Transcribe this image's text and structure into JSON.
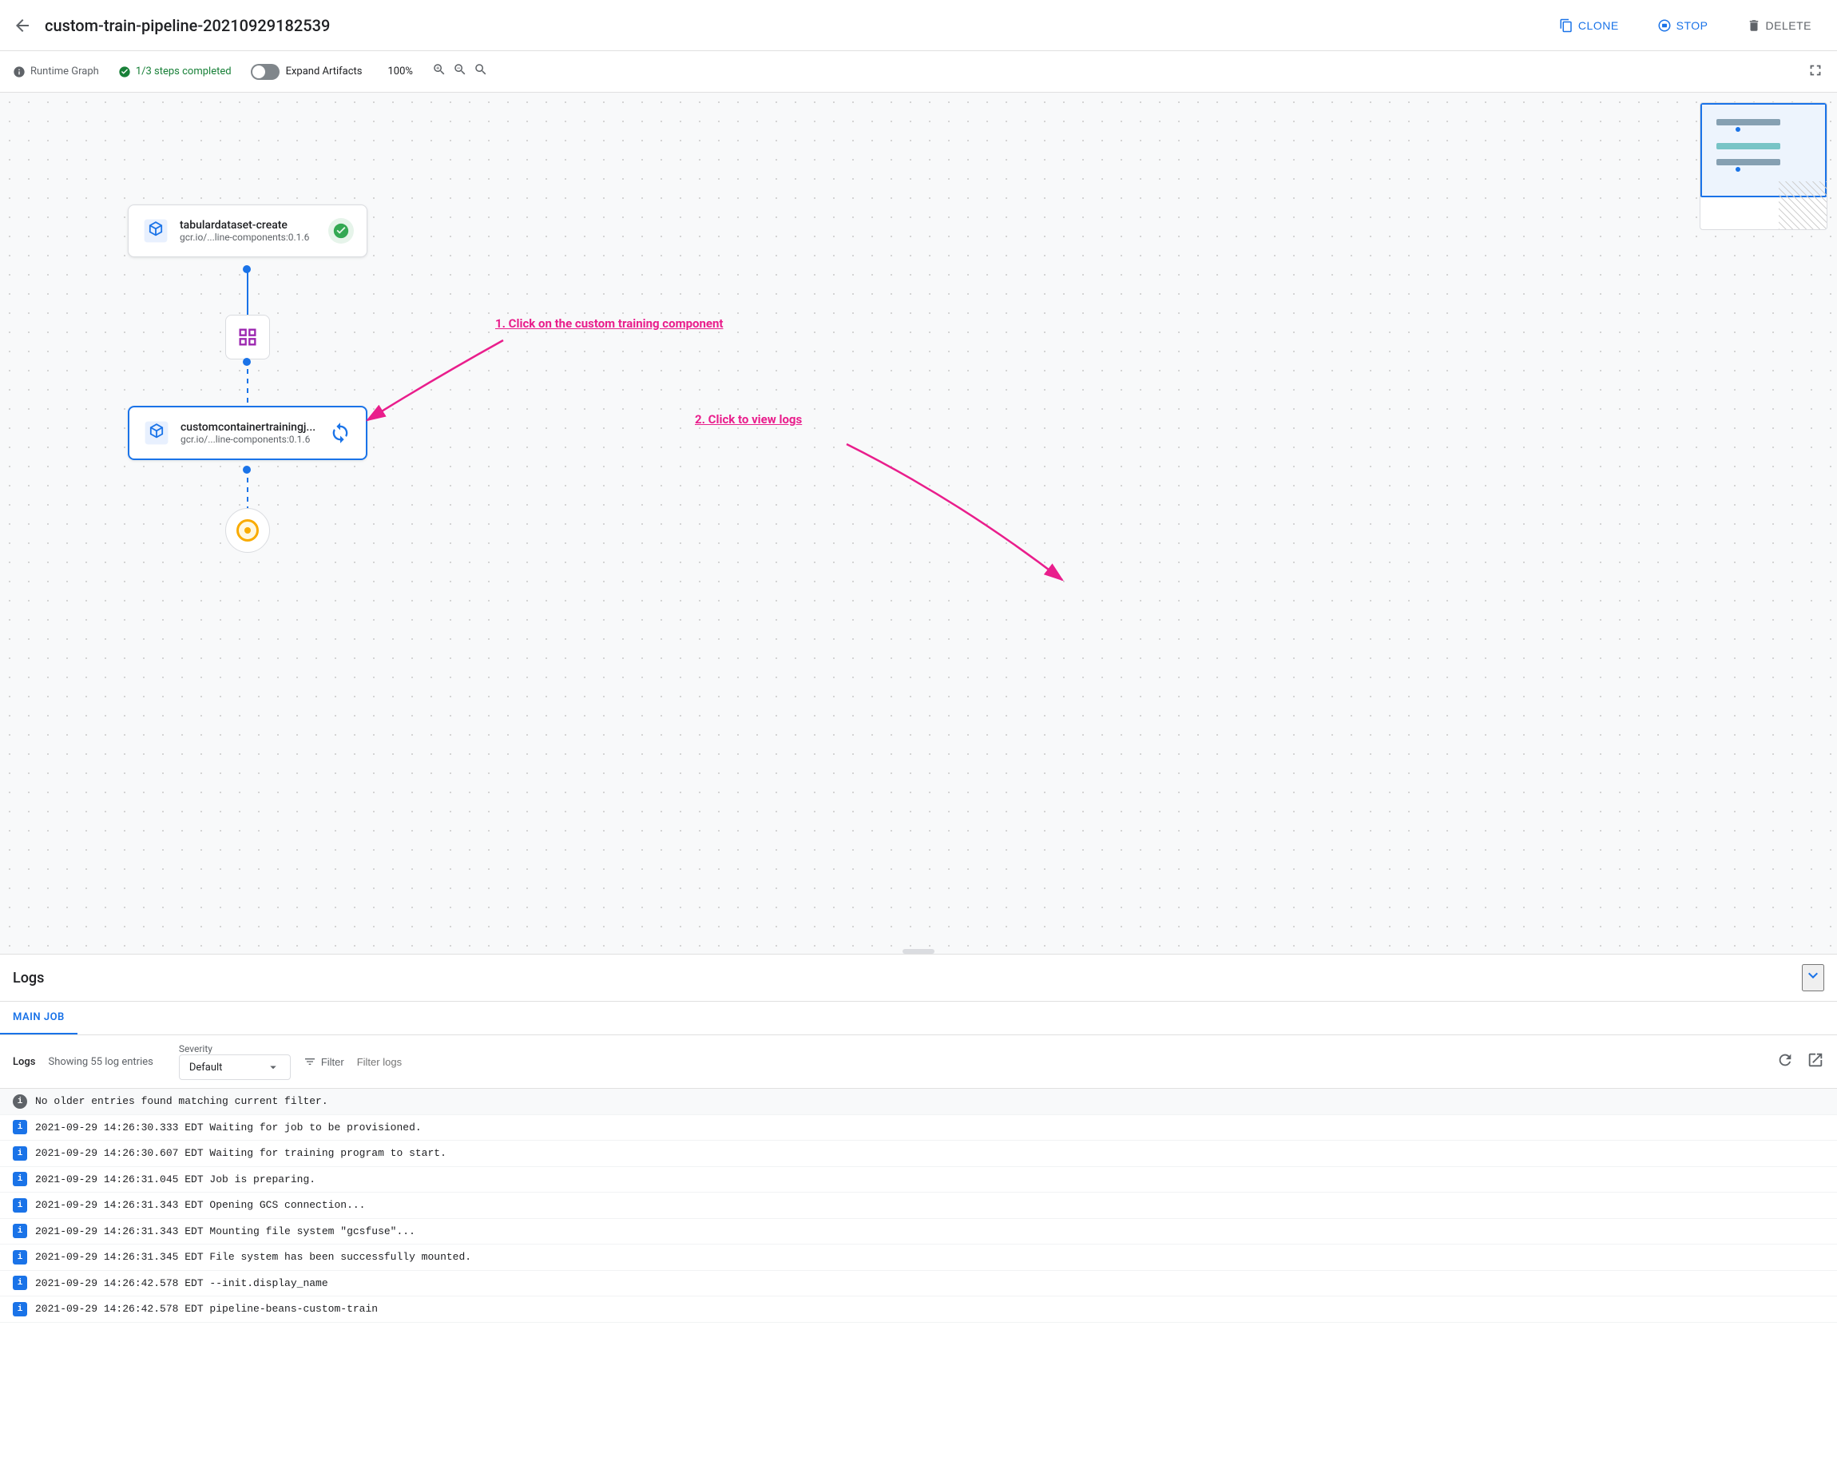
{
  "header": {
    "back_label": "←",
    "title": "custom-train-pipeline-20210929182539",
    "clone_label": "CLONE",
    "stop_label": "STOP",
    "delete_label": "DELETE"
  },
  "toolbar": {
    "runtime_graph_label": "Runtime Graph",
    "steps_completed_label": "1/3 steps completed",
    "expand_artifacts_label": "Expand Artifacts",
    "zoom_level": "100%",
    "zoom_in_label": "+",
    "zoom_out_label": "−",
    "zoom_fit_label": "⊡"
  },
  "canvas": {
    "node1": {
      "name": "tabulardataset-create",
      "sub": "gcr.io/...line-components:0.1.6",
      "status": "completed"
    },
    "node2": {
      "name": "customcontainertrainingj...",
      "sub": "gcr.io/...line-components:0.1.6",
      "status": "running"
    },
    "annotation1": "1. Click on the custom training component",
    "annotation2": "2. Click to view logs"
  },
  "logs": {
    "title": "Logs",
    "tab_label": "MAIN JOB",
    "log_label": "Logs",
    "log_count": "Showing 55 log entries",
    "severity_label": "Severity",
    "severity_value": "Default",
    "filter_label": "Filter",
    "filter_placeholder": "Filter logs",
    "entries": [
      {
        "type": "info",
        "text": "No older entries found matching current filter."
      },
      {
        "type": "info",
        "text": "2021-09-29  14:26:30.333  EDT   Waiting for job to be provisioned."
      },
      {
        "type": "info",
        "text": "2021-09-29  14:26:30.607  EDT   Waiting for training program to start."
      },
      {
        "type": "info",
        "text": "2021-09-29  14:26:31.045  EDT   Job is preparing."
      },
      {
        "type": "info",
        "text": "2021-09-29  14:26:31.343  EDT   Opening GCS connection..."
      },
      {
        "type": "info",
        "text": "2021-09-29  14:26:31.343  EDT   Mounting file system \"gcsfuse\"..."
      },
      {
        "type": "info",
        "text": "2021-09-29  14:26:31.345  EDT   File system has been successfully mounted."
      },
      {
        "type": "info",
        "text": "2021-09-29  14:26:42.578  EDT   --init.display_name"
      },
      {
        "type": "info",
        "text": "2021-09-29  14:26:42.578  EDT   pipeline-beans-custom-train"
      }
    ]
  }
}
